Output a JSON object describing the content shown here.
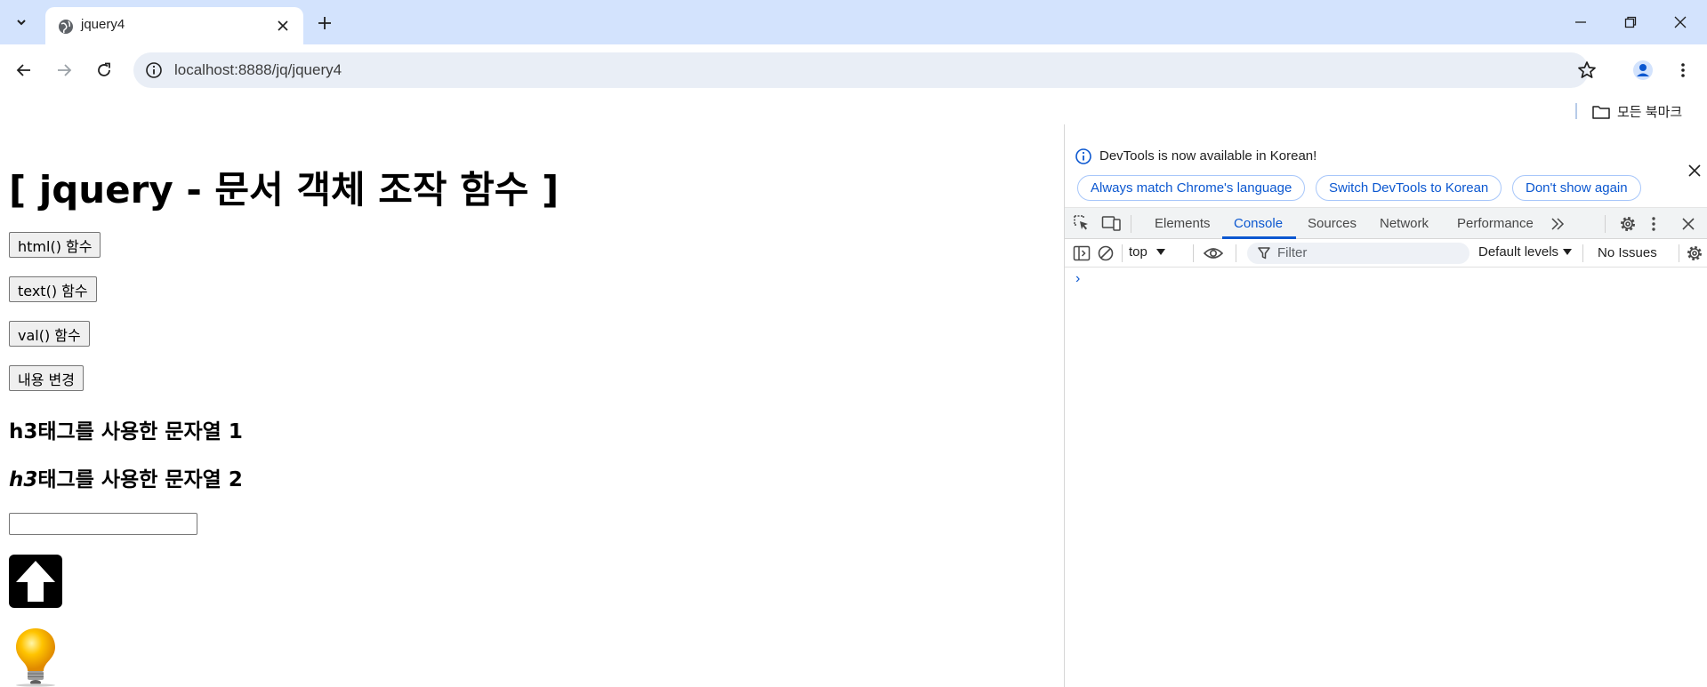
{
  "browser": {
    "tab_title": "jquery4",
    "url": "localhost:8888/jq/jquery4",
    "bookmark_folder": "모든 북마크"
  },
  "page": {
    "title": "[ jquery - 문서 객체 조작 함수 ]",
    "buttons": [
      "html() 함수",
      "text() 함수",
      "val() 함수",
      "내용 변경"
    ],
    "h3_1": "h3태그를 사용한 문자열 1",
    "h3_2_italic": "h3",
    "h3_2_rest": "태그를 사용한 문자열 2",
    "input_value": ""
  },
  "devtools": {
    "info_text": "DevTools is now available in Korean!",
    "info_buttons": [
      "Always match Chrome's language",
      "Switch DevTools to Korean",
      "Don't show again"
    ],
    "tabs": [
      "Elements",
      "Console",
      "Sources",
      "Network",
      "Performance"
    ],
    "active_tab": "Console",
    "context": "top",
    "filter_placeholder": "Filter",
    "levels": "Default levels",
    "issues": "No Issues",
    "prompt": "›"
  },
  "colors": {
    "tabstrip": "#d3e3fd",
    "accent": "#0b57d0"
  }
}
